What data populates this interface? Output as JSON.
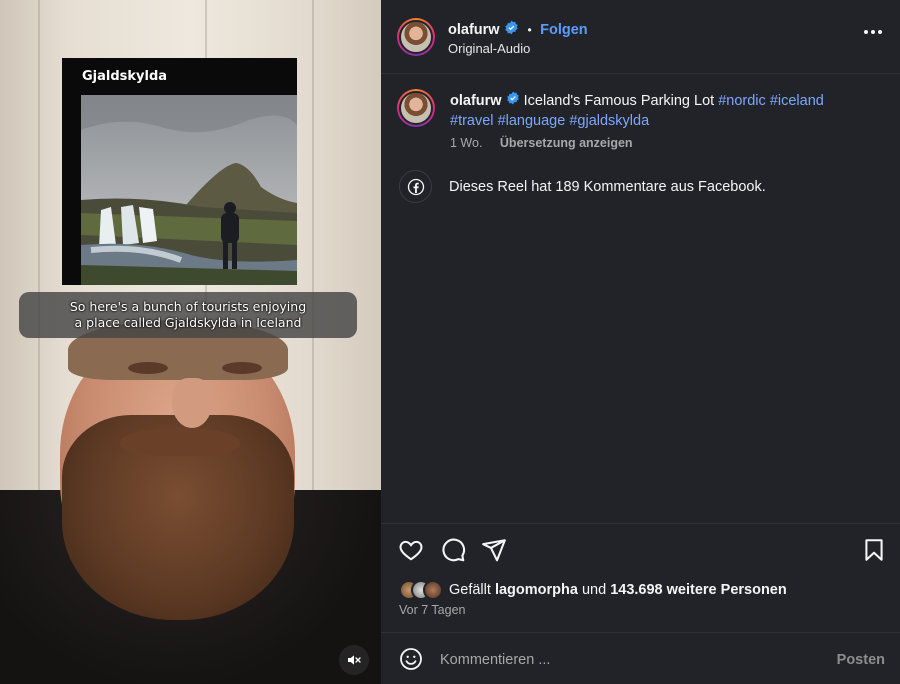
{
  "video": {
    "card_title": "Gjaldskylda",
    "caption_line1": "So here's a bunch of tourists enjoying",
    "caption_line2": "a place called Gjaldskylda in Iceland"
  },
  "header": {
    "username": "olafurw",
    "separator": "•",
    "follow_label": "Folgen",
    "audio_label": "Original-Audio"
  },
  "post": {
    "username": "olafurw",
    "text": "Iceland's Famous Parking Lot",
    "hashtags": [
      "#nordic",
      "#iceland",
      "#travel",
      "#language",
      "#gjaldskylda"
    ],
    "age": "1 Wo.",
    "translate_label": "Übersetzung anzeigen"
  },
  "facebook_notice": "Dieses Reel hat 189 Kommentare aus Facebook.",
  "likes": {
    "prefix": "Gefällt",
    "user": "lagomorpha",
    "middle": "und",
    "count": "143.698 weitere Personen"
  },
  "posted_ago": "Vor 7 Tagen",
  "comment": {
    "placeholder": "Kommentieren ...",
    "post_label": "Posten"
  },
  "colors": {
    "accent_blue": "#5b9dff",
    "hashtag_blue": "#7ea6ff",
    "panel_bg": "#212328"
  }
}
